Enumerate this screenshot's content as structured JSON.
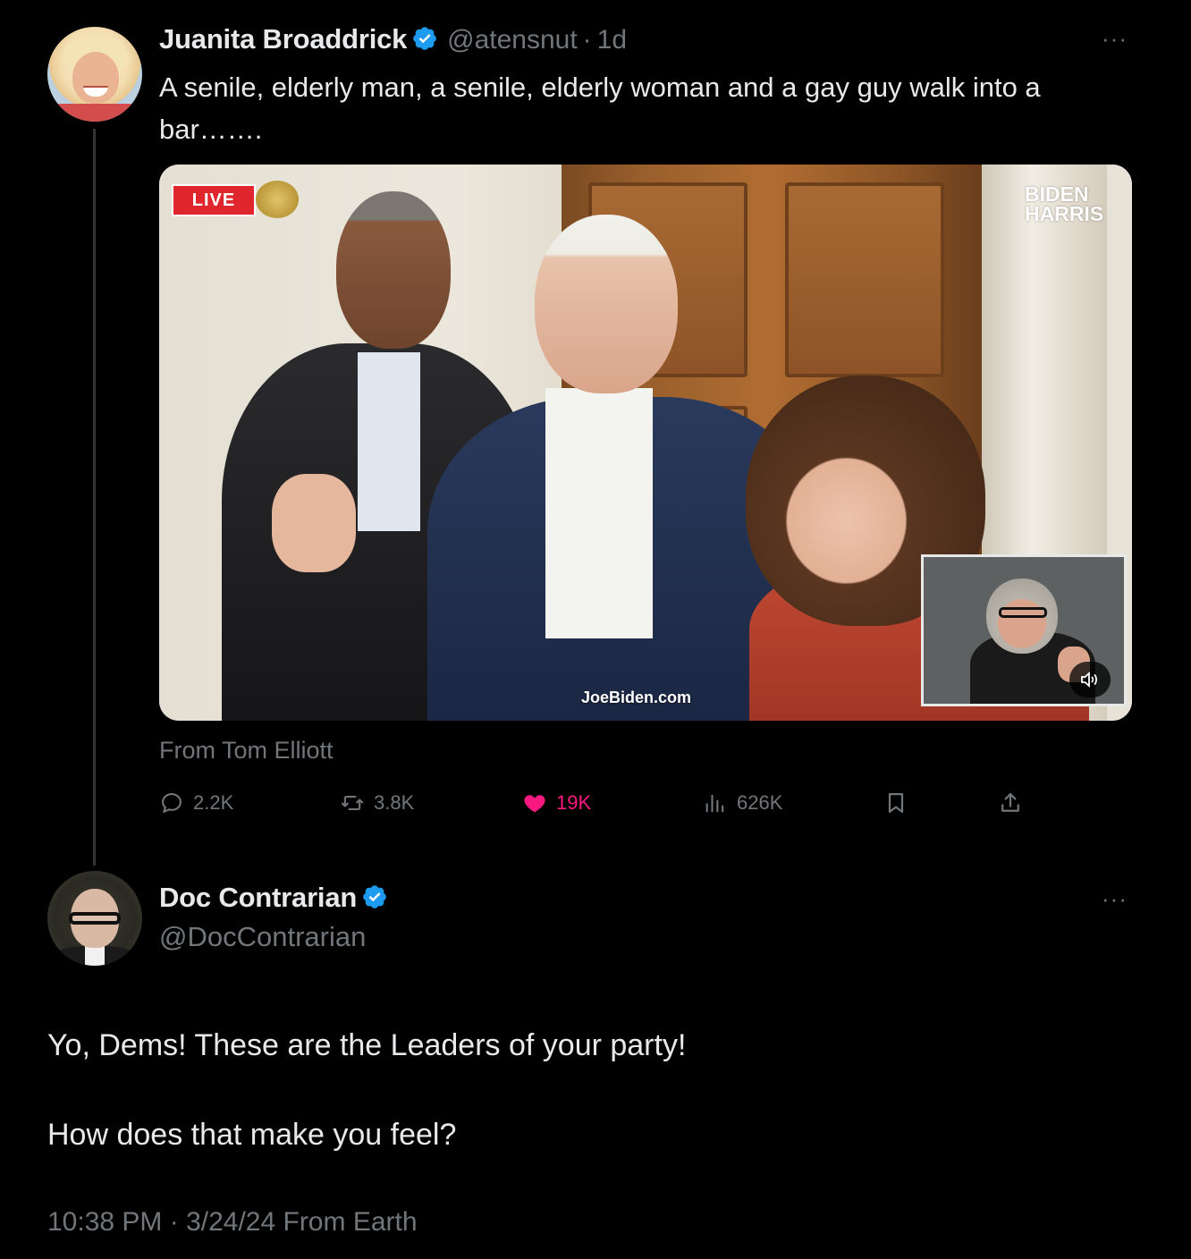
{
  "parent_tweet": {
    "author_name": "Juanita Broaddrick",
    "handle": "@atensnut",
    "time": "1d",
    "separator": "·",
    "more": "···",
    "text": "A senile, elderly man, a senile, elderly woman and a gay guy walk into a bar…….",
    "media": {
      "live_badge": "LIVE",
      "logo_line1": "BIDEN",
      "logo_line2": "HARRIS",
      "watermark": "JoeBiden.com",
      "mute_icon": "speaker-icon"
    },
    "attribution": "From Tom Elliott",
    "stats": {
      "replies": "2.2K",
      "reposts": "3.8K",
      "likes": "19K",
      "views": "626K"
    }
  },
  "main_tweet": {
    "author_name": "Doc Contrarian",
    "handle": "@DocContrarian",
    "more": "···",
    "body_line1": "Yo, Dems! These are the Leaders of your party!",
    "body_line2": "How does that make you feel?",
    "meta": "10:38 PM · 3/24/24 From Earth"
  },
  "colors": {
    "background": "#000000",
    "text": "#e7e9ea",
    "muted": "#71767b",
    "verified": "#1d9bf0",
    "like": "#f91880",
    "thread_line": "#333639",
    "live_badge": "#e0262d"
  }
}
